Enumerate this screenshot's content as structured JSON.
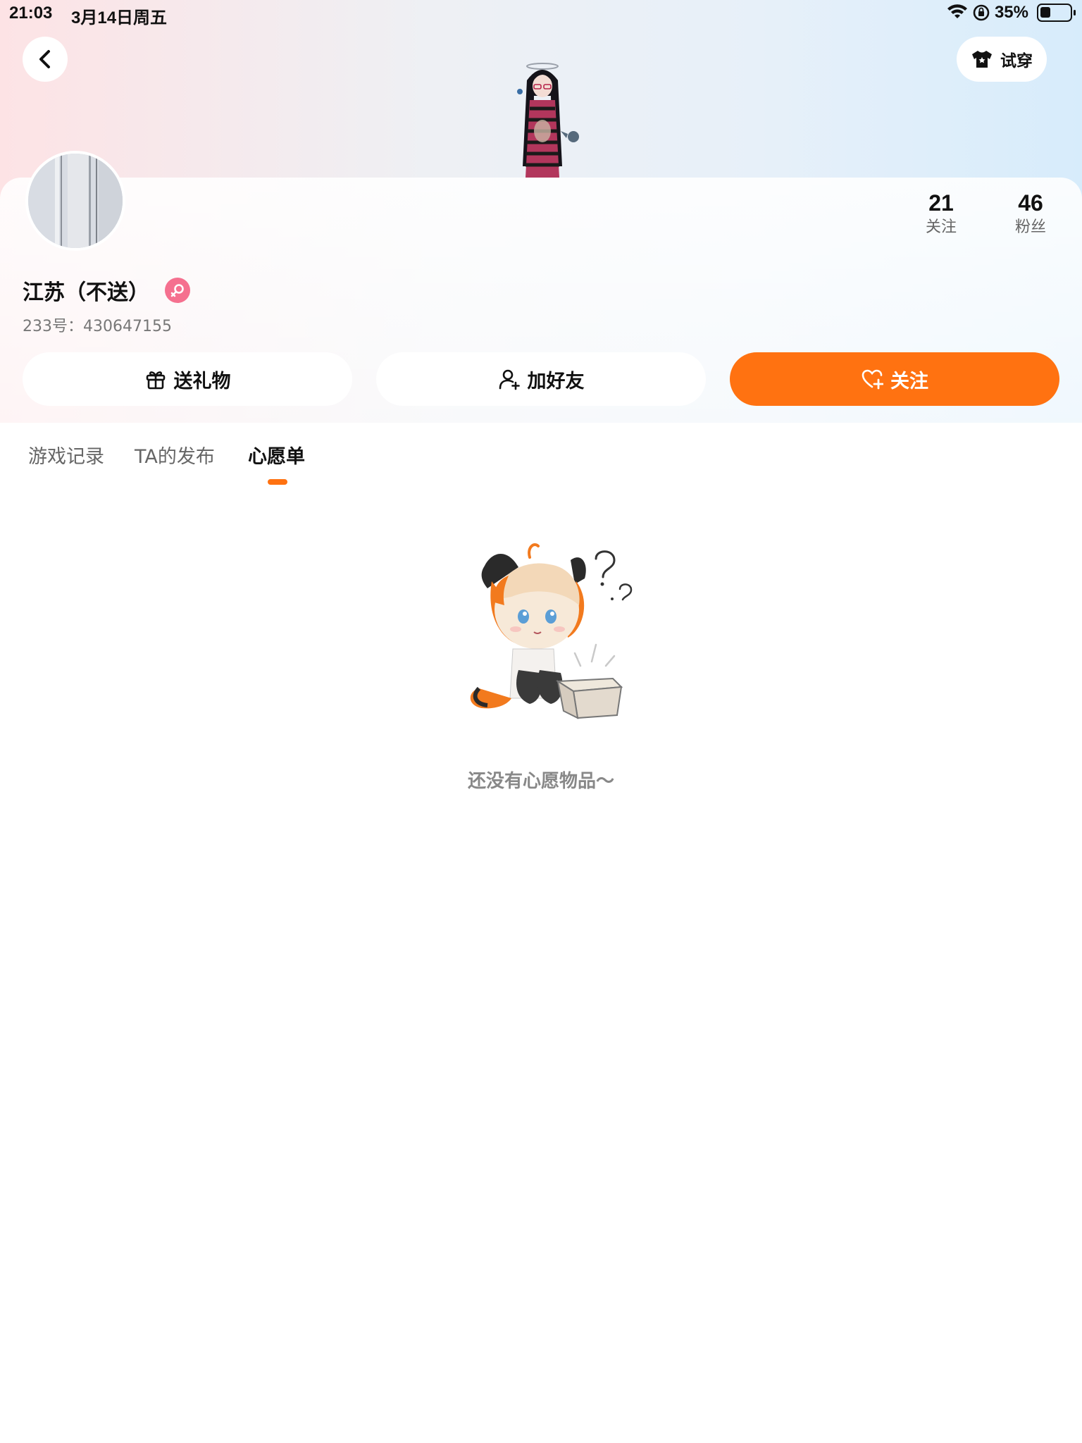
{
  "status_bar": {
    "time": "21:03",
    "date": "3月14日周五",
    "battery": "35%"
  },
  "header": {
    "try_on_label": "试穿"
  },
  "profile": {
    "name": "江苏（不送）",
    "id_text": "233号：430647155",
    "following_count": "21",
    "following_label": "关注",
    "fans_count": "46",
    "fans_label": "粉丝"
  },
  "actions": {
    "gift_label": "送礼物",
    "add_friend_label": "加好友",
    "follow_label": "关注"
  },
  "tabs": [
    {
      "label": "游戏记录",
      "active": false
    },
    {
      "label": "TA的发布",
      "active": false
    },
    {
      "label": "心愿单",
      "active": true
    }
  ],
  "empty_state": {
    "message": "还没有心愿物品～"
  },
  "colors": {
    "accent": "#ff7211",
    "gender_badge": "#f5708f"
  },
  "icons": {
    "back": "chevron-left-icon",
    "try_on": "tshirt-icon",
    "wifi": "wifi-icon",
    "rotation_lock": "rotation-lock-icon",
    "battery": "battery-icon",
    "gender": "female-icon",
    "gift": "gift-icon",
    "add_friend": "add-user-icon",
    "follow": "heart-plus-icon"
  }
}
